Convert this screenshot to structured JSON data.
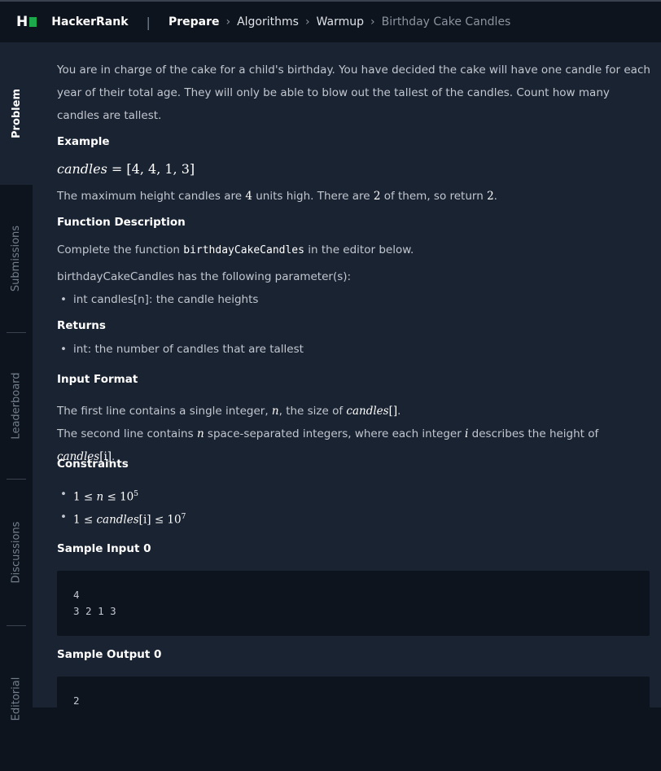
{
  "header": {
    "logo_text": "H",
    "brand": "HackerRank",
    "breadcrumb": [
      "Prepare",
      "Algorithms",
      "Warmup",
      "Birthday Cake Candles"
    ]
  },
  "sidebar": {
    "tabs": [
      "Problem",
      "Submissions",
      "Leaderboard",
      "Discussions",
      "Editorial"
    ]
  },
  "problem": {
    "intro": "You are in charge of the cake for a child's birthday. You have decided the cake will have one candle for each year of their total age. They will only be able to blow out the tallest of the candles. Count how many candles are tallest.",
    "example_heading": "Example",
    "example_lhs": "candles",
    "example_eq": " = [4, 4, 1, 3]",
    "example_text_1": "The maximum height candles are ",
    "example_val_1": "4",
    "example_text_2": " units high. There are ",
    "example_val_2": "2",
    "example_text_3": " of them, so return ",
    "example_val_3": "2",
    "example_text_4": ".",
    "function_heading": "Function Description",
    "function_text_1": "Complete the function ",
    "function_name": "birthdayCakeCandles",
    "function_text_2": " in the editor below.",
    "params_intro": "birthdayCakeCandles has the following parameter(s):",
    "param_1": "int candles[n]: the candle heights",
    "returns_heading": "Returns",
    "returns_1": "int: the number of candles that are tallest",
    "input_heading": "Input Format",
    "input_line1_a": "The first line contains a single integer, ",
    "input_line1_n": "n",
    "input_line1_b": ", the size of ",
    "input_line1_arr": "candles",
    "input_line1_br": "[]",
    "input_line1_c": ".",
    "input_line2_a": "The second line contains ",
    "input_line2_n": "n",
    "input_line2_b": " space-separated integers, where each integer ",
    "input_line2_i": "i",
    "input_line2_c": " describes the height of ",
    "input_line2_arr": "candles",
    "input_line2_idx": "[i]",
    "input_line2_d": ".",
    "constraints_heading": "Constraints",
    "constraint_1_a": "1 ≤ ",
    "constraint_1_n": "n",
    "constraint_1_b": " ≤ 10",
    "constraint_1_exp": "5",
    "constraint_2_a": "1 ≤ ",
    "constraint_2_arr": "candles",
    "constraint_2_idx": "[i]",
    "constraint_2_b": " ≤ 10",
    "constraint_2_exp": "7",
    "sample_input_heading": "Sample Input 0",
    "sample_input_lines": [
      "4",
      "3 2 1 3"
    ],
    "sample_output_heading": "Sample Output 0",
    "sample_output_lines": [
      "2"
    ]
  },
  "colors": {
    "accent": "#1ba94c",
    "background": "#0e141e",
    "panel": "#1a2332"
  }
}
